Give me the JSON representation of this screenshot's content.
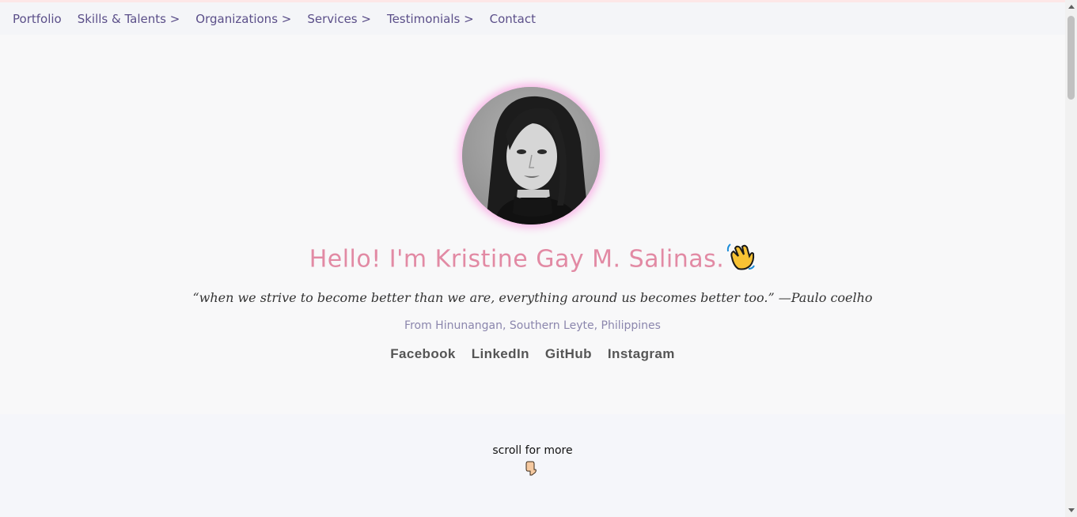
{
  "nav": {
    "items": [
      {
        "label": "Portfolio"
      },
      {
        "label": "Skills & Talents >"
      },
      {
        "label": "Organizations >"
      },
      {
        "label": "Services >"
      },
      {
        "label": "Testimonials >"
      },
      {
        "label": "Contact"
      }
    ]
  },
  "hero": {
    "headline": "Hello! I'm Kristine Gay M. Salinas.",
    "quote": "“when we strive to become better than we are, everything around us becomes better too.” —Paulo coelho",
    "location": "From Hinunangan, Southern Leyte, Philippines",
    "social": [
      {
        "label": "Facebook"
      },
      {
        "label": "LinkedIn"
      },
      {
        "label": "GitHub"
      },
      {
        "label": "Instagram"
      }
    ]
  },
  "scroll": {
    "label": "scroll for more"
  },
  "colors": {
    "headline": "#e28aa4",
    "nav_text": "#5b4f89",
    "avatar_glow": "#f9b8e8"
  },
  "icons": {
    "wave": "waving-hand-icon",
    "pointer": "pointing-down-hand-icon"
  }
}
